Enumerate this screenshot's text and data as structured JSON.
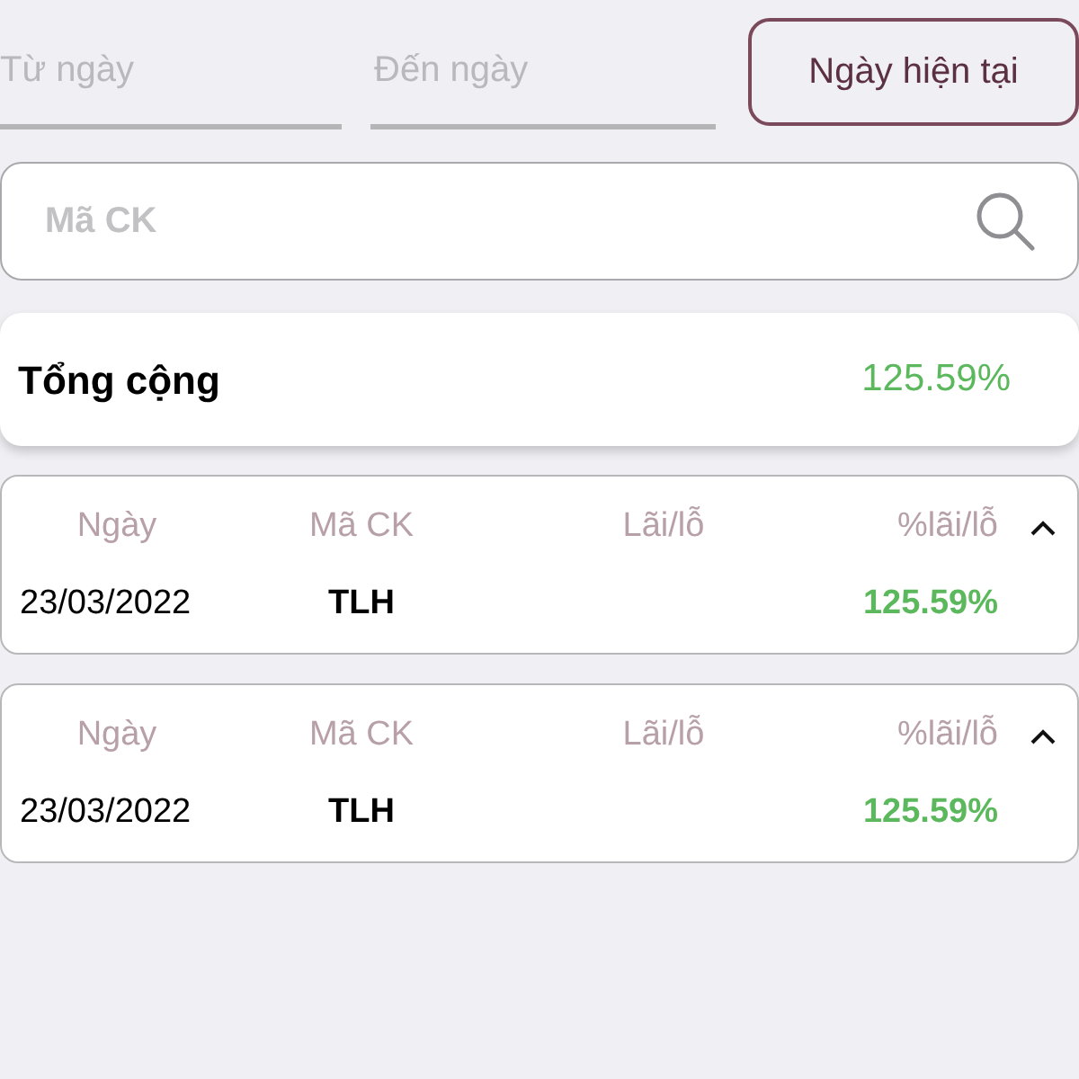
{
  "date_filter": {
    "from": {
      "placeholder": "Từ ngày"
    },
    "to": {
      "placeholder": "Đến ngày"
    },
    "today_button": "Ngày hiện tại"
  },
  "search": {
    "placeholder": "Mã CK"
  },
  "total": {
    "label": "Tổng cộng",
    "value": "125.59%"
  },
  "records": [
    {
      "headers": [
        "Ngày",
        "Mã CK",
        "Lãi/lỗ",
        "%lãi/lỗ"
      ],
      "date": "23/03/2022",
      "symbol": "TLH",
      "percent": "125.59%",
      "expanded": true
    },
    {
      "headers": [
        "Ngày",
        "Mã CK",
        "Lãi/lỗ",
        "%lãi/lỗ"
      ],
      "date": "23/03/2022",
      "symbol": "TLH",
      "percent": "125.59%",
      "expanded": true
    }
  ]
}
